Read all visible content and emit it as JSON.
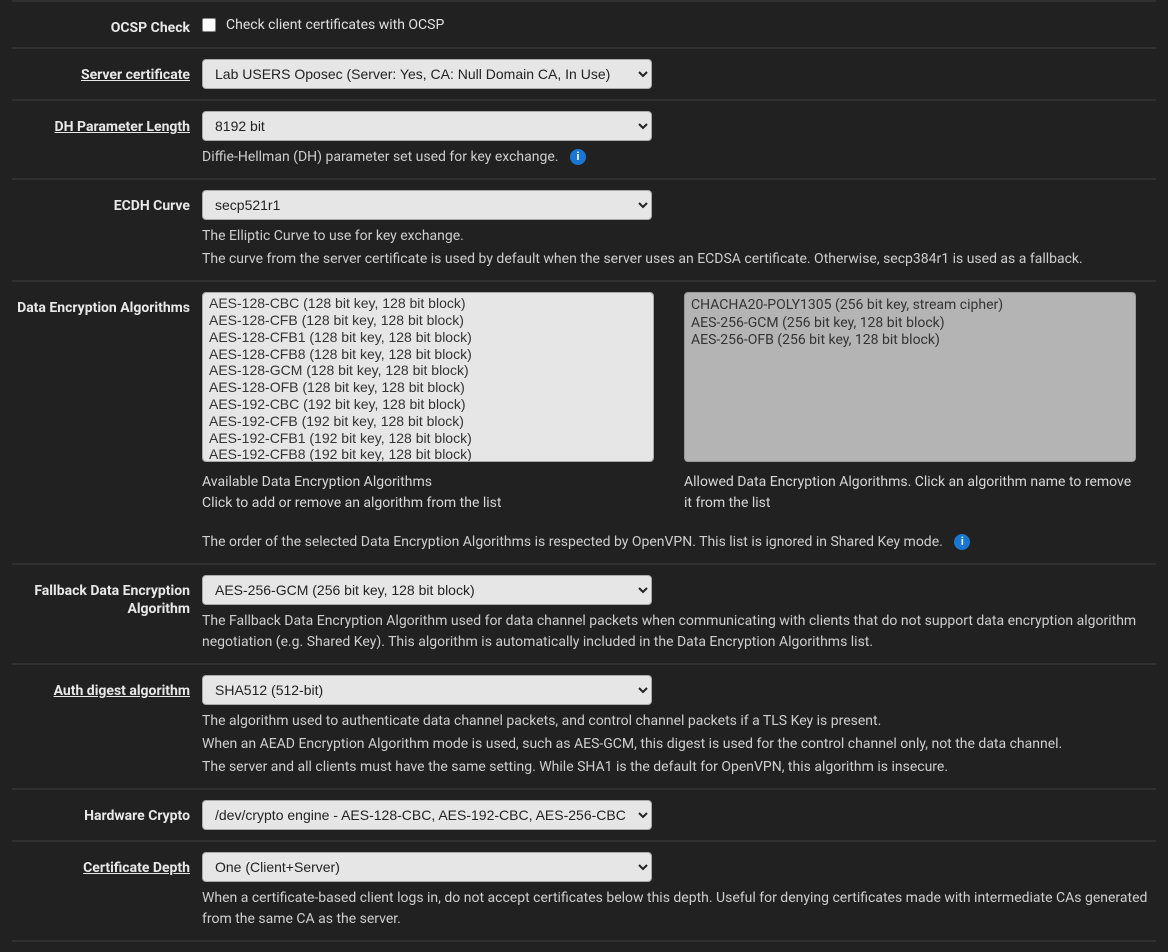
{
  "ocsp": {
    "label": "OCSP Check",
    "checkbox_label": "Check client certificates with OCSP"
  },
  "server_cert": {
    "label": "Server certificate",
    "value": "Lab USERS Oposec (Server: Yes, CA: Null Domain CA, In Use)"
  },
  "dh": {
    "label": "DH Parameter Length",
    "value": "8192 bit",
    "help": "Diffie-Hellman (DH) parameter set used for key exchange."
  },
  "ecdh": {
    "label": "ECDH Curve",
    "value": "secp521r1",
    "help1": "The Elliptic Curve to use for key exchange.",
    "help2": "The curve from the server certificate is used by default when the server uses an ECDSA certificate. Otherwise, secp384r1 is used as a fallback."
  },
  "dea": {
    "label": "Data Encryption Algorithms",
    "available": [
      "AES-128-CBC (128 bit key, 128 bit block)",
      "AES-128-CFB (128 bit key, 128 bit block)",
      "AES-128-CFB1 (128 bit key, 128 bit block)",
      "AES-128-CFB8 (128 bit key, 128 bit block)",
      "AES-128-GCM (128 bit key, 128 bit block)",
      "AES-128-OFB (128 bit key, 128 bit block)",
      "AES-192-CBC (192 bit key, 128 bit block)",
      "AES-192-CFB (192 bit key, 128 bit block)",
      "AES-192-CFB1 (192 bit key, 128 bit block)",
      "AES-192-CFB8 (192 bit key, 128 bit block)"
    ],
    "allowed": [
      "CHACHA20-POLY1305 (256 bit key, stream cipher)",
      "AES-256-GCM (256 bit key, 128 bit block)",
      "AES-256-OFB (256 bit key, 128 bit block)"
    ],
    "avail_caption1": "Available Data Encryption Algorithms",
    "avail_caption2": "Click to add or remove an algorithm from the list",
    "allowed_caption": "Allowed Data Encryption Algorithms. Click an algorithm name to remove it from the list",
    "footer_help": "The order of the selected Data Encryption Algorithms is respected by OpenVPN. This list is ignored in Shared Key mode."
  },
  "fallback": {
    "label": "Fallback Data Encryption Algorithm",
    "value": "AES-256-GCM (256 bit key, 128 bit block)",
    "help": "The Fallback Data Encryption Algorithm used for data channel packets when communicating with clients that do not support data encryption algorithm negotiation (e.g. Shared Key). This algorithm is automatically included in the Data Encryption Algorithms list."
  },
  "auth": {
    "label": "Auth digest algorithm",
    "value": "SHA512 (512-bit)",
    "help1": "The algorithm used to authenticate data channel packets, and control channel packets if a TLS Key is present.",
    "help2": "When an AEAD Encryption Algorithm mode is used, such as AES-GCM, this digest is used for the control channel only, not the data channel.",
    "help3": "The server and all clients must have the same setting. While SHA1 is the default for OpenVPN, this algorithm is insecure."
  },
  "hw": {
    "label": "Hardware Crypto",
    "value": "/dev/crypto engine - AES-128-CBC, AES-192-CBC, AES-256-CBC"
  },
  "depth": {
    "label": "Certificate Depth",
    "value": "One (Client+Server)",
    "help": "When a certificate-based client logs in, do not accept certificates below this depth. Useful for denying certificates made with intermediate CAs generated from the same CA as the server."
  }
}
